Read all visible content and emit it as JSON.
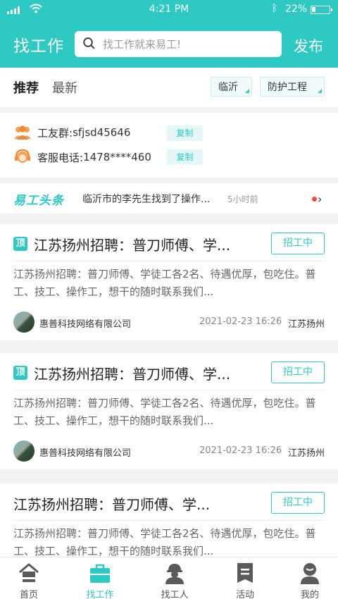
{
  "status_bar": {
    "time": "4:21 PM",
    "battery": "22%"
  },
  "header": {
    "title": "找工作",
    "search_placeholder": "找工作就来易工!",
    "publish_label": "发布"
  },
  "tabs": [
    {
      "label": "推荐"
    },
    {
      "label": "最新"
    }
  ],
  "filters": [
    {
      "label": "临沂"
    },
    {
      "label": "防护工程"
    }
  ],
  "contact": {
    "group_label": "工友群:",
    "group_value": "sfjsd45646",
    "phone_label": "客服电话:",
    "phone_value": "1478****460",
    "copy_label": "复制"
  },
  "news": {
    "brand": "易工头条",
    "text": "临沂市的李先生找到了操作...",
    "time_ago": "5小时前"
  },
  "jobs": [
    {
      "badge": "顶",
      "title": "江苏扬州招聘：普刀师傅、学...",
      "status": "招工中",
      "desc": "江苏扬州招聘：普刀师傅、学徒工各2名、待遇优厚，包吃住。普工、技工、操作工，想干的随时联系我们...",
      "company": "惠普科技网络有限公司",
      "date": "2021-02-23 16:26",
      "location": "江苏扬州"
    },
    {
      "badge": "顶",
      "title": "江苏扬州招聘：普刀师傅、学...",
      "status": "招工中",
      "desc": "江苏扬州招聘：普刀师傅、学徒工各2名、待遇优厚，包吃住。普工、技工、操作工，想干的随时联系我们...",
      "company": "惠普科技网络有限公司",
      "date": "2021-02-23 16:26",
      "location": "江苏扬州"
    },
    {
      "badge": "",
      "title": "江苏扬州招聘：普刀师傅、学...",
      "status": "招工中",
      "desc": "江苏扬州招聘：普刀师傅、学徒工各2名、待遇优厚，包吃住。普工、技工、操作工，想干的随时联系我们...",
      "company": "",
      "date": "",
      "location": ""
    }
  ],
  "tabbar": [
    {
      "label": "首页",
      "icon": "home-icon"
    },
    {
      "label": "找工作",
      "icon": "briefcase-icon"
    },
    {
      "label": "找工人",
      "icon": "worker-icon"
    },
    {
      "label": "活动",
      "icon": "activity-icon"
    },
    {
      "label": "我的",
      "icon": "profile-icon"
    }
  ],
  "colors": {
    "accent": "#2ec9c2",
    "background": "#f2f2f2",
    "red_dot": "#f04a3a"
  }
}
